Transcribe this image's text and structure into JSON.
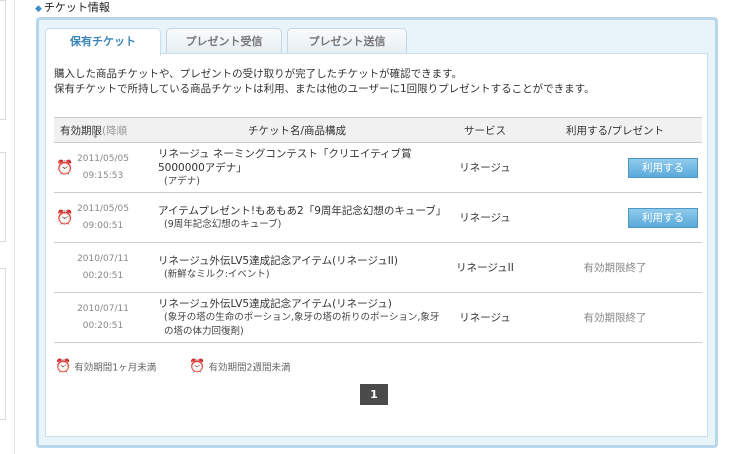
{
  "section": {
    "title": "チケット情報"
  },
  "tabs": [
    {
      "label": "保有チケット",
      "active": true
    },
    {
      "label": "プレゼント受信",
      "active": false
    },
    {
      "label": "プレゼント送信",
      "active": false
    }
  ],
  "description": [
    "購入した商品チケットや、プレゼントの受け取りが完了したチケットが確認できます。",
    "保有チケットで所持している商品チケットは利用、または他のユーザーに1回限りプレゼントすることができます。"
  ],
  "table": {
    "headers": {
      "expiry": "有効期限",
      "expiry_sort": "(降順",
      "name": "チケット名/商品構成",
      "service": "サービス",
      "action": "利用する/プレゼント"
    },
    "rows": [
      {
        "date": "2011/05/05",
        "time": "09:15:53",
        "icon": "clock-blue-icon",
        "name": "リネージュ ネーミングコンテスト「クリエイティブ賞5000000アデナ」",
        "sub": "(アデナ)",
        "service": "リネージュ",
        "action": "利用する",
        "expired": false
      },
      {
        "date": "2011/05/05",
        "time": "09:00:51",
        "icon": "clock-blue-icon",
        "name": "アイテムプレゼント!もあもあ2「9周年記念幻想のキューブ」",
        "sub": "(9周年記念幻想のキューブ)",
        "service": "リネージュ",
        "action": "利用する",
        "expired": false
      },
      {
        "date": "2010/07/11",
        "time": "00:20:51",
        "icon": "",
        "name": "リネージュ外伝LV5達成記念アイテム(リネージュII)",
        "sub": "(新鮮なミルク:イベント)",
        "service": "リネージュII",
        "action": "有効期限終了",
        "expired": true
      },
      {
        "date": "2010/07/11",
        "time": "00:20:51",
        "icon": "",
        "name": "リネージュ外伝LV5達成記念アイテム(リネージュ)",
        "sub": "(象牙の塔の生命のポーション,象牙の塔の祈りのポーション,象牙の塔の体力回復剤)",
        "service": "リネージュ",
        "action": "有効期限終了",
        "expired": true
      }
    ]
  },
  "legend": {
    "one_month": "有効期間1ヶ月未満",
    "two_weeks": "有効期間2週間未満"
  },
  "pagination": {
    "current": "1"
  },
  "colors": {
    "accent": "#3a86b8",
    "button": "#5aa9da",
    "frame": "#b8d7ea"
  }
}
